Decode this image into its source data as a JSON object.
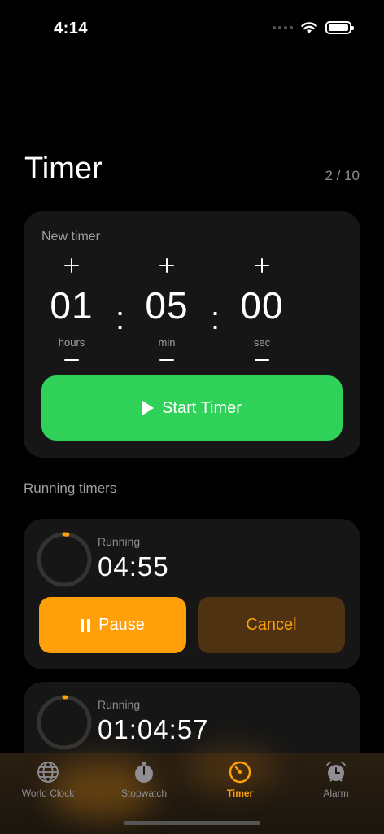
{
  "status_bar": {
    "time": "4:14"
  },
  "header": {
    "title": "Timer",
    "counter": "2 / 10"
  },
  "new_timer": {
    "label": "New timer",
    "hours": {
      "value": "01",
      "caption": "hours"
    },
    "minutes": {
      "value": "05",
      "caption": "min"
    },
    "seconds": {
      "value": "00",
      "caption": "sec"
    },
    "separator": ":",
    "start_label": "Start Timer"
  },
  "running_section": {
    "label": "Running timers"
  },
  "running_timers": [
    {
      "status": "Running",
      "time": "04:55",
      "progress": 0.02,
      "pause_label": "Pause",
      "cancel_label": "Cancel"
    },
    {
      "status": "Running",
      "time": "01:04:57",
      "progress": 0.01
    }
  ],
  "tabs": [
    {
      "label": "World Clock",
      "icon": "globe-icon",
      "active": false
    },
    {
      "label": "Stopwatch",
      "icon": "stopwatch-icon",
      "active": false
    },
    {
      "label": "Timer",
      "icon": "timer-icon",
      "active": true
    },
    {
      "label": "Alarm",
      "icon": "alarm-clock-icon",
      "active": false
    }
  ],
  "colors": {
    "accent": "#ff9f0a",
    "start": "#30d158",
    "card": "#161616",
    "background": "#000000"
  }
}
